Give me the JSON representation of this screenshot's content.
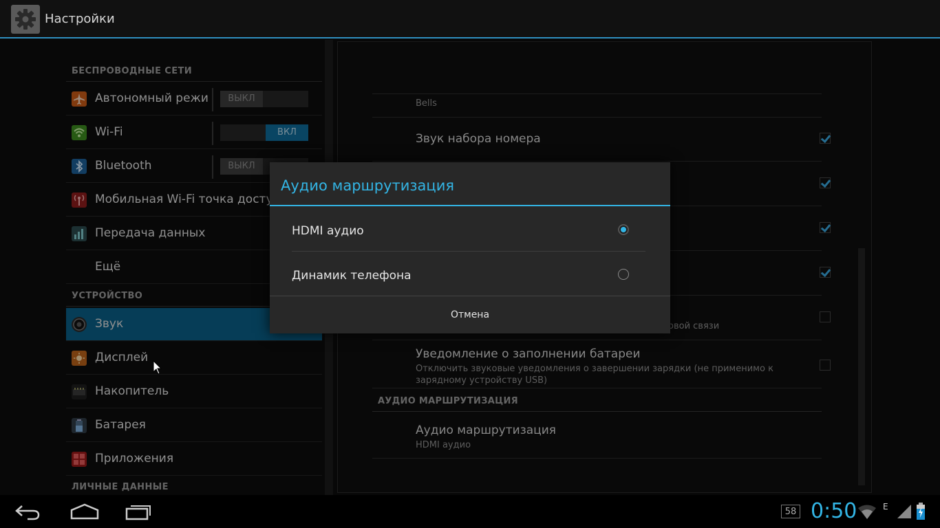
{
  "app": {
    "title": "Настройки",
    "icon": "gear-icon"
  },
  "left": {
    "categories": {
      "wireless": "БЕСПРОВОДНЫЕ СЕТИ",
      "device": "УСТРОЙСТВО",
      "personal": "ЛИЧНЫЕ ДАННЫЕ"
    },
    "items": [
      {
        "label": "Автономный режим",
        "icon": "airplane-icon",
        "toggle": "ВЫКЛ"
      },
      {
        "label": "Wi-Fi",
        "icon": "wifi-icon",
        "toggle": "ВКЛ"
      },
      {
        "label": "Bluetooth",
        "icon": "bluetooth-icon",
        "toggle": "ВЫКЛ"
      },
      {
        "label": "Мобильная Wi-Fi точка доступа",
        "icon": "hotspot-icon"
      },
      {
        "label": "Передача данных",
        "icon": "data-usage-icon"
      },
      {
        "label": "Ещё"
      },
      {
        "label": "Звук",
        "icon": "speaker-icon"
      },
      {
        "label": "Дисплей",
        "icon": "display-icon"
      },
      {
        "label": "Накопитель",
        "icon": "storage-icon"
      },
      {
        "label": "Батарея",
        "icon": "battery-icon"
      },
      {
        "label": "Приложения",
        "icon": "apps-icon"
      }
    ]
  },
  "right": {
    "top_sub": "Bells",
    "dial_tone": "Звук набора номера",
    "partial_sub": "овой связи",
    "battery_notify": {
      "title": "Уведомление о заполнении батареи",
      "sub": "Отключить звуковые уведомления о завершении зарядки (не применимо к зарядному устройству USB)"
    },
    "audio_category": "АУДИО МАРШРУТИЗАЦИЯ",
    "audio_route": {
      "title": "Аудио маршрутизация",
      "sub": "HDMI аудио"
    }
  },
  "dialog": {
    "title": "Аудио маршрутизация",
    "options": [
      "HDMI аудио",
      "Динамик телефона"
    ],
    "selected": "HDMI аудио",
    "cancel": "Отмена",
    "accent": "#33b5e5"
  },
  "status": {
    "time": "0:50",
    "notification_count": "58",
    "network": "E"
  }
}
